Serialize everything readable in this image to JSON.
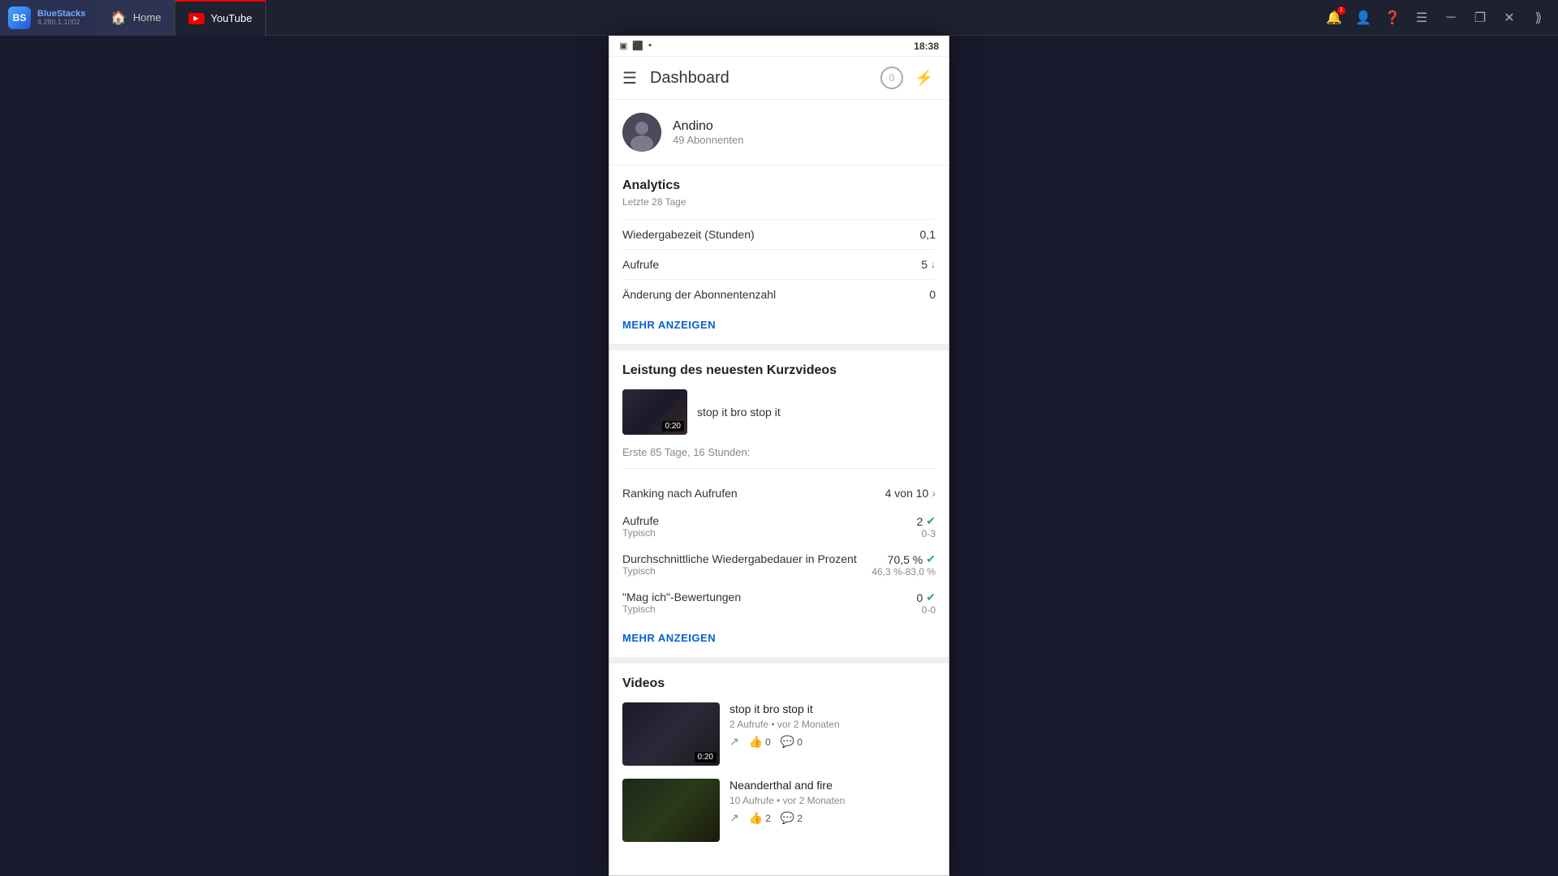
{
  "titlebar": {
    "brand": "BlueStacks",
    "version": "4.280.1.1002",
    "tab_home": "Home",
    "tab_youtube": "YouTube"
  },
  "statusbar": {
    "time": "18:38",
    "icons": [
      "▣",
      "⬛",
      "▪"
    ]
  },
  "topnav": {
    "title": "Dashboard",
    "circle_badge": "0"
  },
  "profile": {
    "channel_name": "Andino",
    "subscriber_count": "49 Abonnenten"
  },
  "analytics": {
    "section_title": "Analytics",
    "section_subtitle": "Letzte 28 Tage",
    "rows": [
      {
        "label": "Wiedergabezeit (Stunden)",
        "value": "0,1",
        "has_down": false
      },
      {
        "label": "Aufrufe",
        "value": "5",
        "has_down": true
      },
      {
        "label": "Änderung der Abonnentenzahl",
        "value": "0",
        "has_down": false
      }
    ],
    "more_btn": "MEHR ANZEIGEN"
  },
  "kurzvideos": {
    "section_title": "Leistung des neuesten Kurzvideos",
    "video_title": "stop it bro stop it",
    "video_duration": "0:20",
    "period": "Erste 85 Tage, 16 Stunden:",
    "ranking_label": "Ranking nach Aufrufen",
    "ranking_value": "4 von 10",
    "stats": [
      {
        "label": "Aufrufe",
        "sublabel": "Typisch",
        "value": "2",
        "range": "0-3",
        "has_check": true
      },
      {
        "label": "Durchschnittliche Wiedergabedauer in Prozent",
        "sublabel": "Typisch",
        "value": "70,5 %",
        "range": "46,3 %-83,0 %",
        "has_check": true
      },
      {
        "label": "\"Mag ich\"-Bewertungen",
        "sublabel": "Typisch",
        "value": "0",
        "range": "0-0",
        "has_check": true
      }
    ],
    "more_btn": "MEHR ANZEIGEN"
  },
  "videos": {
    "section_title": "Videos",
    "items": [
      {
        "title": "stop it bro stop it",
        "meta": "2 Aufrufe • vor 2 Monaten",
        "duration": "0:20",
        "likes": "0",
        "comments": "0",
        "thumb_type": "dark"
      },
      {
        "title": "Neanderthal and fire",
        "meta": "10 Aufrufe • vor 2 Monaten",
        "duration": "",
        "likes": "2",
        "comments": "2",
        "thumb_type": "green"
      }
    ]
  }
}
